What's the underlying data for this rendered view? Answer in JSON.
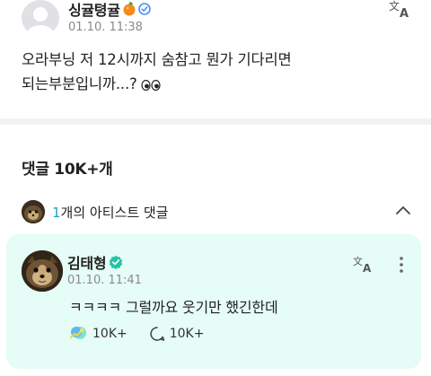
{
  "post": {
    "author": "싱귤텽귤",
    "time": "01.10. 11:38",
    "body_line1": "오라부닝 저 12시까지 숨참고 뭔가 기다리면",
    "body_line2": "되는부분입니까...?"
  },
  "comments": {
    "count_label": "댓글 10K+개",
    "artist_count_num": "1",
    "artist_count_text": "개의 아티스트 댓글"
  },
  "artist_comment": {
    "author": "김태형",
    "time": "01.10. 11:41",
    "text": "ㅋㅋㅋㅋ 그럴까요 웃기만 했긴한데",
    "likes": "10K+",
    "replies": "10K+"
  },
  "colors": {
    "card_background": "#e6fcf6",
    "verify_teal": "#24c4a5",
    "verify_blue": "#4a8cf7",
    "count_accent": "#1ea3c4"
  },
  "icons": [
    "translate-icon",
    "chevron-up-icon",
    "more-vertical-icon",
    "like-icon",
    "reply-icon",
    "verified-badge-icon",
    "orange-emoji-icon",
    "eyes-emoji-icon"
  ]
}
